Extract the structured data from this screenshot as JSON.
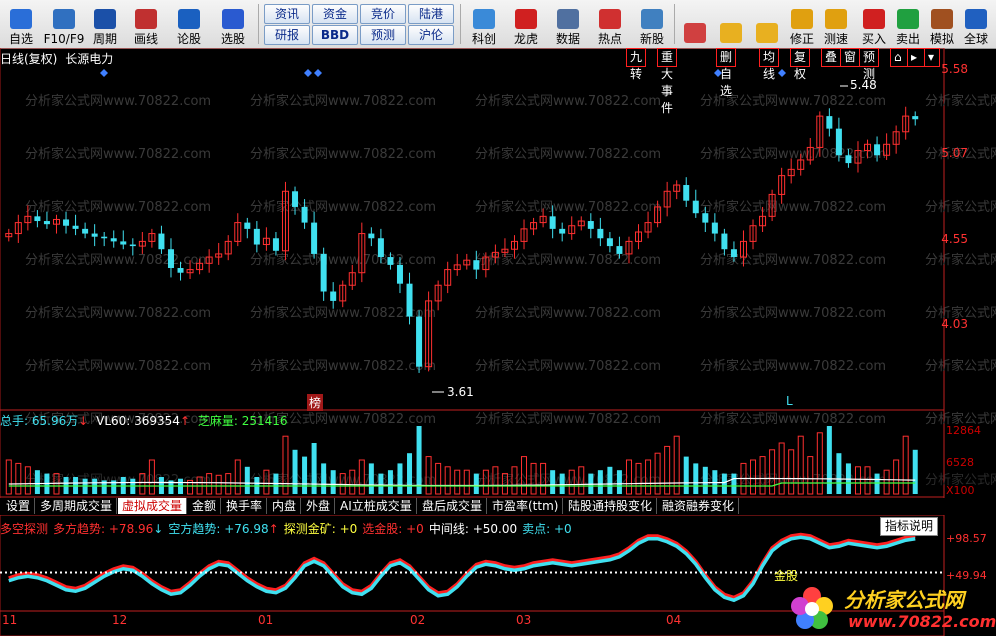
{
  "toolbar": {
    "items": [
      {
        "label": "自选",
        "icon": "star-icon",
        "color": "#2a6ed8"
      },
      {
        "label": "F10/F9",
        "icon": "f10-icon",
        "color": "#3070c0"
      },
      {
        "label": "周期",
        "icon": "period-icon",
        "color": "#1b50a8"
      },
      {
        "label": "画线",
        "icon": "pencil-icon",
        "color": "#c03030"
      },
      {
        "label": "论股",
        "icon": "discuss-icon",
        "color": "#1a60c0"
      },
      {
        "label": "选股",
        "icon": "select-stock-icon",
        "color": "#2a5ad0"
      }
    ],
    "pair_buttons": [
      {
        "top": "资讯",
        "bottom": "研报"
      },
      {
        "top": "资金",
        "bottom": "BBD"
      },
      {
        "top": "竞价",
        "bottom": "预测"
      },
      {
        "top": "陆港",
        "bottom": "沪伦"
      }
    ],
    "items2": [
      {
        "label": "科创",
        "icon": "kechuang-icon",
        "color": "#3a8ad8"
      },
      {
        "label": "龙虎",
        "icon": "dragon-tiger-icon",
        "color": "#d02020"
      },
      {
        "label": "数据",
        "icon": "pe-data-icon",
        "color": "#5070a0"
      },
      {
        "label": "热点",
        "icon": "hot-icon",
        "color": "#d03030"
      },
      {
        "label": "新股",
        "icon": "ipo-icon",
        "color": "#4080c0"
      }
    ],
    "items3": [
      {
        "label": "",
        "icon": "grid-icon",
        "color": "#d04040"
      },
      {
        "label": "",
        "icon": "back-arrow-icon",
        "color": "#e8b020"
      },
      {
        "label": "",
        "icon": "up-down-icon",
        "color": "#e8b020"
      },
      {
        "label": "修正",
        "icon": "fix-icon",
        "color": "#e0a010"
      },
      {
        "label": "测速",
        "icon": "clock-icon",
        "color": "#e0a010"
      },
      {
        "label": "买入",
        "icon": "buy-icon",
        "color": "#d02020"
      },
      {
        "label": "卖出",
        "icon": "sell-icon",
        "color": "#20a040"
      },
      {
        "label": "模拟",
        "icon": "hammer-icon",
        "color": "#a05020"
      },
      {
        "label": "全球",
        "icon": "globe-icon",
        "color": "#2060c0"
      }
    ]
  },
  "chart": {
    "period": "日线(复权)",
    "stock": "长源电力",
    "tags": [
      "九转",
      "重大事件",
      "删自选",
      "均线",
      "复权",
      "叠",
      "窗",
      "预测"
    ],
    "price_axis": [
      "5.58",
      "5.07",
      "4.55",
      "4.03"
    ],
    "high_label": "5.48",
    "low_label": "3.61",
    "bang_label": "榜",
    "l_label": "L",
    "watermark": "分析家公式网www.70822.com"
  },
  "volume": {
    "header": {
      "total_label": "总手: ",
      "total_value": "65.96万",
      "vl60_label": "VL60: ",
      "vl60_value": "369354",
      "extra_label": "芝麻量: ",
      "extra_value": "251416"
    },
    "axis": [
      "12864",
      "6528",
      "X100"
    ]
  },
  "panel_tabs": [
    "设置",
    "多周期成交量",
    "虚拟成交量",
    "金额",
    "换手率",
    "内盘",
    "外盘",
    "AI立桩成交量",
    "盘后成交量",
    "市盈率(ttm)",
    "陆股通持股变化",
    "融资融券变化"
  ],
  "indicator": {
    "name": "多空探测",
    "items": [
      {
        "label": "多方趋势: ",
        "value": "+78.96",
        "arrow": "↓",
        "color": "#ff3030"
      },
      {
        "label": "空方趋势: ",
        "value": "+76.98",
        "arrow": "↑",
        "color": "#40e0f0"
      },
      {
        "label": "探测金矿: ",
        "value": "+0",
        "arrow": "",
        "color": "#ffff40"
      },
      {
        "label": "选金股: ",
        "value": "+0",
        "arrow": "",
        "color": "#ff3030"
      },
      {
        "label": "中间线: ",
        "value": "+50.00",
        "arrow": "",
        "color": "#ffffff"
      },
      {
        "label": "卖点: ",
        "value": "+0",
        "arrow": "",
        "color": "#40e0f0"
      }
    ],
    "axis": [
      "+98.57",
      "+49.94"
    ],
    "gold_label": "金股",
    "explain_button": "指标说明"
  },
  "x_axis": [
    "11",
    "12",
    "01",
    "02",
    "03",
    "04"
  ],
  "logo": {
    "title": "分析家公式网",
    "url": "www.70822.com"
  },
  "chart_data": {
    "type": "candlestick",
    "series": [
      {
        "name": "price",
        "values": [
          4.55,
          4.62,
          4.66,
          4.63,
          4.61,
          4.64,
          4.6,
          4.58,
          4.55,
          4.53,
          4.52,
          4.5,
          4.48,
          4.47,
          4.5,
          4.55,
          4.45,
          4.33,
          4.3,
          4.32,
          4.36,
          4.4,
          4.42,
          4.5,
          4.62,
          4.58,
          4.48,
          4.52,
          4.44,
          4.82,
          4.72,
          4.62,
          4.42,
          4.18,
          4.12,
          4.22,
          4.3,
          4.55,
          4.52,
          4.4,
          4.35,
          4.23,
          4.02,
          3.7,
          4.12,
          4.22,
          4.32,
          4.35,
          4.38,
          4.32,
          4.4,
          4.43,
          4.45,
          4.5,
          4.58,
          4.62,
          4.66,
          4.58,
          4.55,
          4.6,
          4.63,
          4.58,
          4.52,
          4.47,
          4.42,
          4.5,
          4.56,
          4.62,
          4.72,
          4.82,
          4.86,
          4.76,
          4.68,
          4.62,
          4.55,
          4.45,
          4.4,
          4.5,
          4.6,
          4.66,
          4.8,
          4.92,
          4.96,
          5.02,
          5.1,
          5.3,
          5.22,
          5.05,
          5.0,
          5.08,
          5.12,
          5.05,
          5.12,
          5.2,
          5.3,
          5.28
        ]
      }
    ]
  }
}
